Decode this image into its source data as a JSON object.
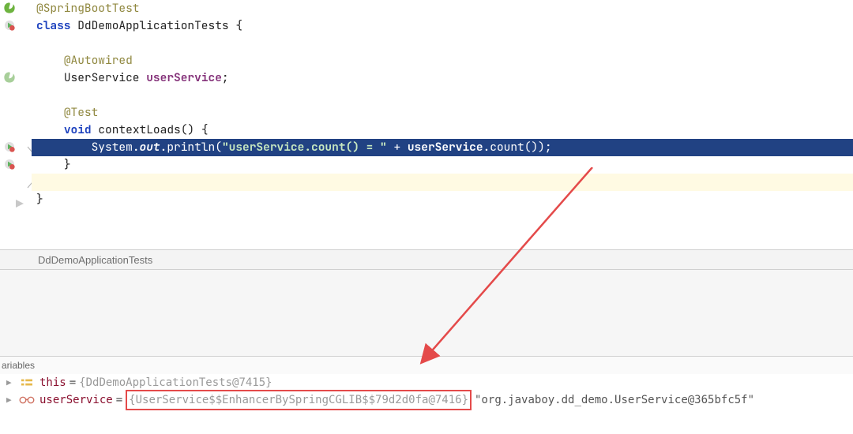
{
  "code": {
    "annot_springboottest": "@SpringBootTest",
    "kw_class": "class",
    "class_name": "DdDemoApplicationTests",
    "brace_open": "{",
    "annot_autowired": "@Autowired",
    "type_userservice": "UserService",
    "field_userservice": "userService",
    "semicolon": ";",
    "annot_test": "@Test",
    "kw_void": "void",
    "method_name": "contextLoads",
    "parens_empty": "()",
    "sysout_system": "System",
    "sysout_out": "out",
    "sysout_println": "println",
    "str_literal": "\"userService.count() = \"",
    "plus": " + ",
    "call_userservice": "userService",
    "call_count": ".count()",
    "paren_close_semi": ");",
    "brace_close": "}",
    "dot": "."
  },
  "breadcrumb": {
    "item": "DdDemoApplicationTests"
  },
  "vars": {
    "header": "ariables",
    "this_name": "this",
    "this_val": "{DdDemoApplicationTests@7415}",
    "us_name": "userService",
    "us_type": "{UserService$$EnhancerBySpringCGLIB$$79d2d0fa@7416}",
    "us_str": "\"org.javaboy.dd_demo.UserService@365bfc5f\""
  }
}
